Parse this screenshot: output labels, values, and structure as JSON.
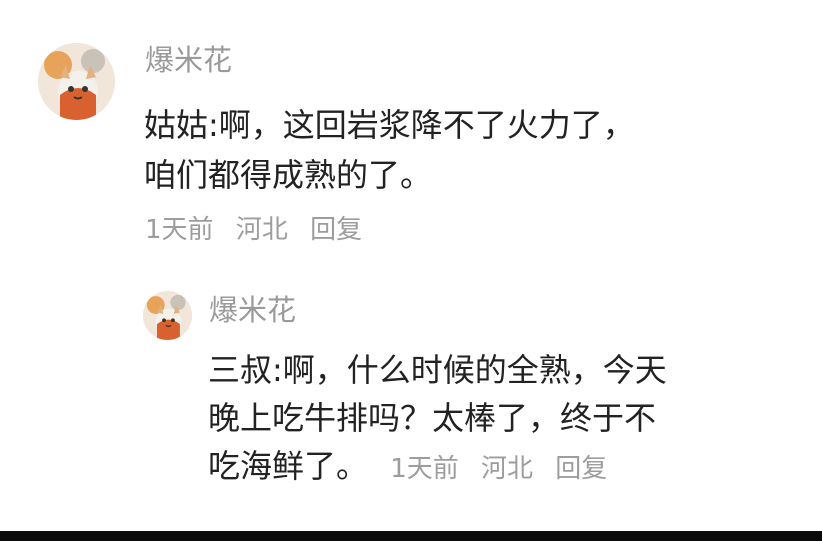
{
  "comment": {
    "username": "爆米花",
    "avatar_icon": "cat-avatar-icon",
    "lines": [
      "姑姑:啊，这回岩浆降不了火力了，",
      "咱们都得成熟的了。"
    ],
    "time": "1天前",
    "location": "河北",
    "reply_label": "回复"
  },
  "reply": {
    "username": "爆米花",
    "avatar_icon": "cat-avatar-icon",
    "lines": [
      "三叔:啊，什么时候的全熟，今天",
      "晚上吃牛排吗？太棒了，终于不",
      "吃海鲜了。"
    ],
    "time": "1天前",
    "location": "河北",
    "reply_label": "回复"
  },
  "colors": {
    "text": "#222222",
    "meta": "#9d9d9d",
    "username": "#9a9a9a",
    "bottom_bar": "#0a0a0a"
  }
}
